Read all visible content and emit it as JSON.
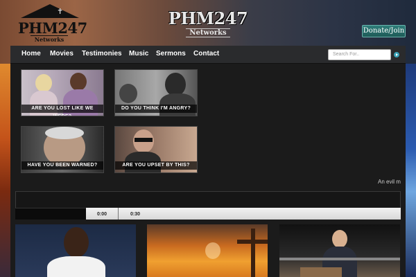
{
  "header": {
    "logo_left_brand": "PHM247",
    "logo_left_sub": "Networks",
    "logo_center_brand": "PHM247",
    "logo_center_sub": "Networks",
    "donate_label": "Donate/Join"
  },
  "nav": {
    "items": [
      {
        "label": "Home"
      },
      {
        "label": "Movies"
      },
      {
        "label": "Testimonies"
      },
      {
        "label": "Music"
      },
      {
        "label": "Sermons"
      },
      {
        "label": "Contact"
      }
    ]
  },
  "search": {
    "placeholder": "Search For..",
    "button_icon": "arrow-right-icon"
  },
  "thumbnails": [
    {
      "caption": "ARE YOU LOST LIKE WE WERE?"
    },
    {
      "caption": "DO YOU THINK I'M ANGRY?"
    },
    {
      "caption": "HAVE YOU BEEN WARNED?"
    },
    {
      "caption": "ARE YOU UPSET BY THIS?"
    }
  ],
  "ticker_text": "An evil m",
  "player": {
    "current_time": "0:00",
    "duration": "0:30"
  },
  "colors": {
    "donate_bg": "#1e5a57",
    "nav_bg": "#2a2b2d",
    "panel_bg": "#1b1b1b",
    "search_button": "#3aa3b8"
  }
}
